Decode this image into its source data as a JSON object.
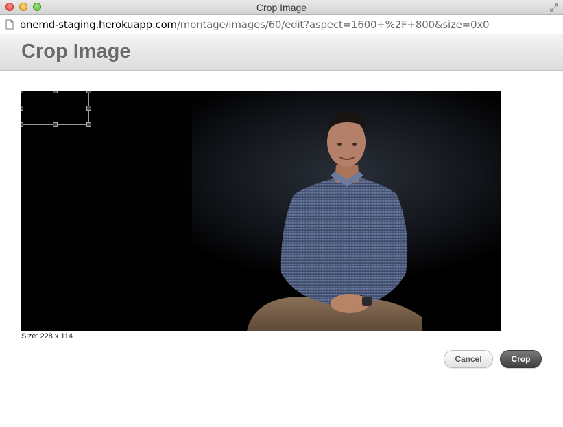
{
  "window": {
    "title": "Crop Image"
  },
  "address_bar": {
    "url_host": "onemd-staging.herokuapp.com",
    "url_path": "/montage/images/60/edit?aspect=1600+%2F+800&size=0x0"
  },
  "page": {
    "title": "Crop Image"
  },
  "crop": {
    "size_label": "Size: 228 x 114"
  },
  "actions": {
    "cancel_label": "Cancel",
    "crop_label": "Crop"
  },
  "colors": {
    "crop_button": "#4a4a4a",
    "page_title": "#6a6a6a"
  }
}
